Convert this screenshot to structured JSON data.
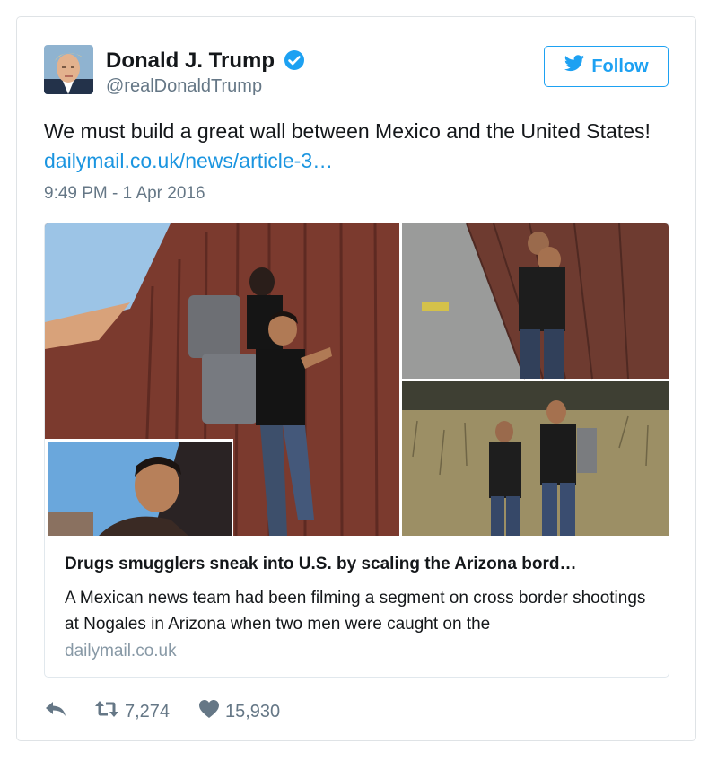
{
  "author": {
    "display_name": "Donald J. Trump",
    "handle": "@realDonaldTrump",
    "verified": true
  },
  "follow_button": {
    "label": "Follow"
  },
  "tweet": {
    "text": "We must build a great wall between Mexico and the United States! ",
    "link_text": "dailymail.co.uk/news/article-3…",
    "timestamp": "9:49 PM - 1 Apr 2016"
  },
  "link_card": {
    "title": "Drugs smugglers sneak into U.S. by scaling the Arizona bord…",
    "description": "A Mexican news team had been filming a segment on cross border shootings at Nogales in Arizona when two men were caught on the",
    "domain": "dailymail.co.uk"
  },
  "actions": {
    "reply_icon": "reply-icon",
    "retweet_icon": "retweet-icon",
    "like_icon": "heart-icon",
    "retweet_count": "7,274",
    "like_count": "15,930"
  },
  "colors": {
    "accent": "#1da1f2",
    "link": "#1b95e0",
    "secondary_text": "#657786",
    "border": "#e1e8ed"
  }
}
